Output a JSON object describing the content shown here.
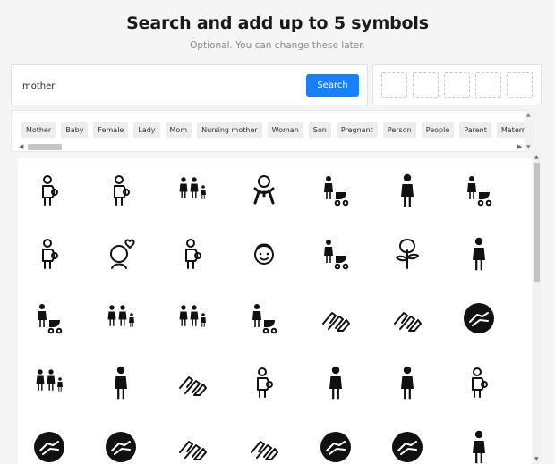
{
  "header": {
    "title": "Search and add up to 5 symbols",
    "subtitle": "Optional. You can change these later."
  },
  "search": {
    "value": "mother",
    "button_label": "Search"
  },
  "selected_slots": 5,
  "tags": [
    "Mother",
    "Baby",
    "Female",
    "Lady",
    "Mom",
    "Nursing mother",
    "Woman",
    "Son",
    "Pregnant",
    "Person",
    "People",
    "Parent",
    "Maternity"
  ],
  "results": [
    "mother-with-child-icon",
    "pregnant-woman-outline-icon",
    "family-group-icon",
    "baby-icon",
    "woman-with-stroller-outline-icon",
    "pregnant-woman-icon",
    "woman-with-stroller-icon",
    "pregnant-girl-icon",
    "happy-mother-heart-icon",
    "mother-holding-baby-icon",
    "grandmother-face-icon",
    "parent-with-stroller-icon",
    "rose-icon",
    "pregnant-silhouette-icon",
    "woman-with-pram-icon",
    "family-walking-icon",
    "parent-child-icon",
    "mother-pushing-pram-icon",
    "caring-hands-icon",
    "helping-hands-icon",
    "hands-circle-icon",
    "mother-two-children-icon",
    "mother-kneeling-child-icon",
    "hand-clasp-icon",
    "mother-breastfeeding-icon",
    "woman-holding-baby-icon",
    "mother-holding-infant-icon",
    "mother-embrace-icon",
    "hands-circle-icon",
    "hands-circle-icon",
    "helping-hands-icon",
    "hand-clasp-icon",
    "hands-circle-icon",
    "hands-circle-icon",
    "woman-holding-child-icon"
  ]
}
